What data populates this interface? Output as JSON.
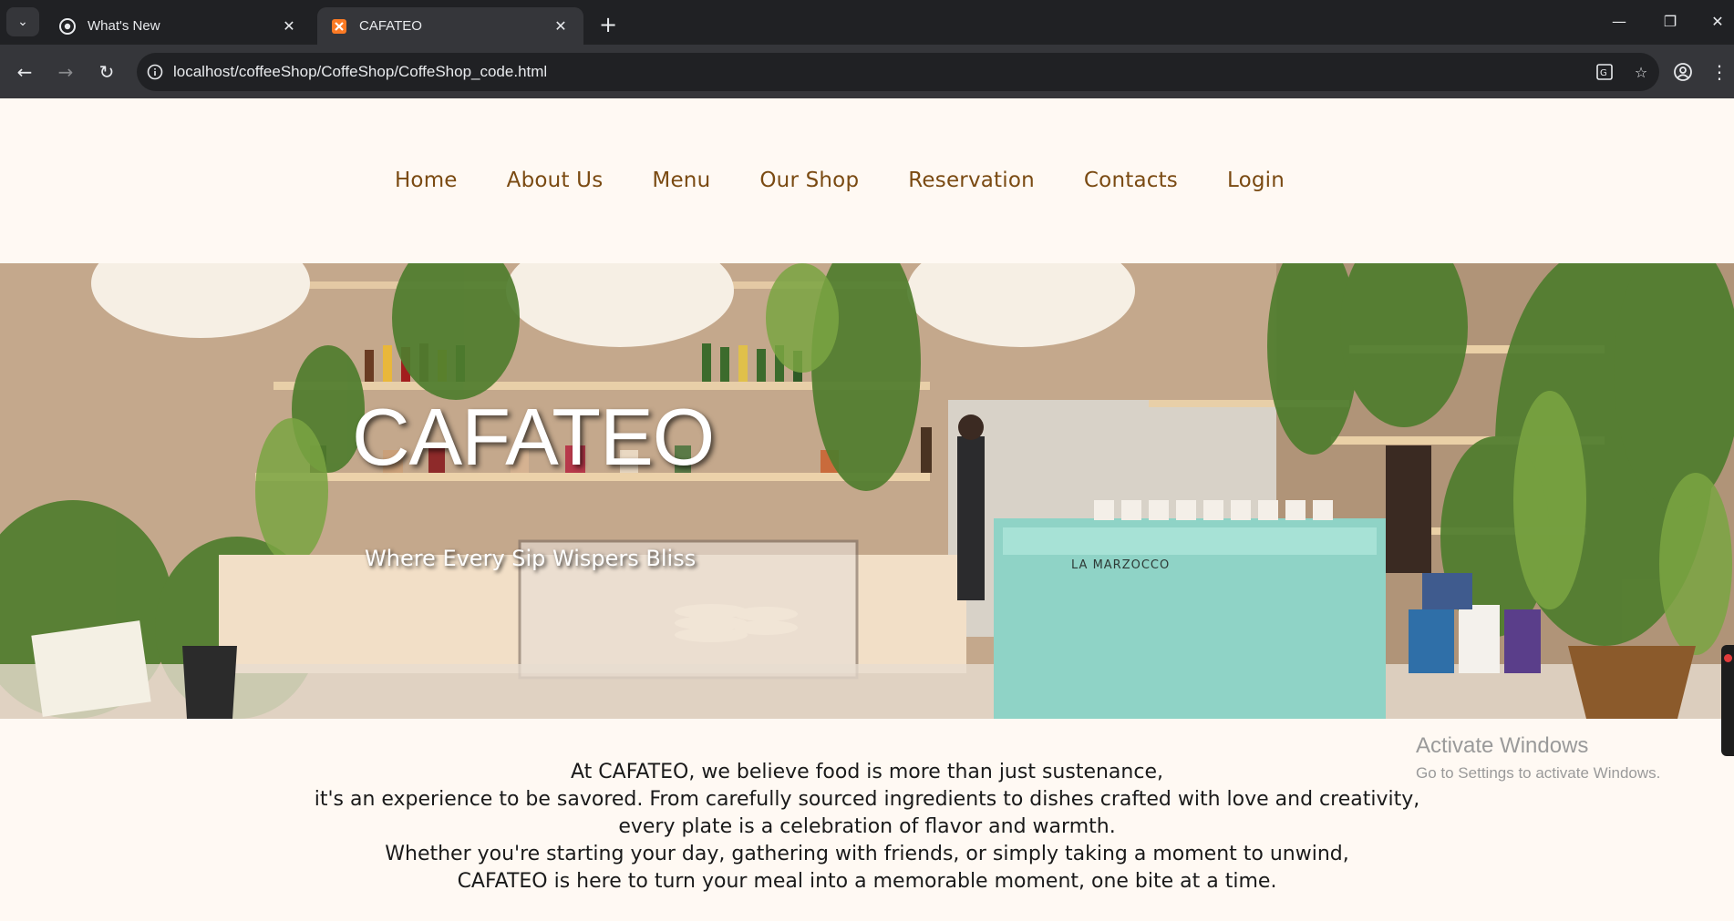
{
  "browser": {
    "tabs": [
      {
        "title": "What's New",
        "favicon": "chrome-icon",
        "active": false
      },
      {
        "title": "CAFATEO",
        "favicon": "xampp-icon",
        "active": true
      }
    ],
    "address_bar": {
      "url": "localhost/coffeeShop/CoffeShop/CoffeShop_code.html"
    }
  },
  "site": {
    "nav": [
      "Home",
      "About Us",
      "Menu",
      "Our Shop",
      "Reservation",
      "Contacts",
      "Login"
    ],
    "hero": {
      "title": "CAFATEO",
      "subtitle": "Where Every Sip Wispers Bliss",
      "storefront_sign": "LA MARZOCCO"
    },
    "intro_lines": [
      "At CAFATEO, we believe food is more than just sustenance,",
      "it's an experience to be savored. From carefully sourced ingredients to dishes crafted with love and creativity,",
      "every plate is a celebration of flavor and warmth.",
      "Whether you're starting your day, gathering with friends, or simply taking a moment to unwind,",
      "CAFATEO is here to turn your meal into a memorable moment, one bite at a time."
    ]
  },
  "os_overlay": {
    "title": "Activate Windows",
    "subtitle": "Go to Settings to activate Windows."
  },
  "colors": {
    "page_bg": "#fff9f3",
    "nav_text": "#7a4a12",
    "chrome_dark": "#202124",
    "chrome_toolbar": "#35363a"
  }
}
